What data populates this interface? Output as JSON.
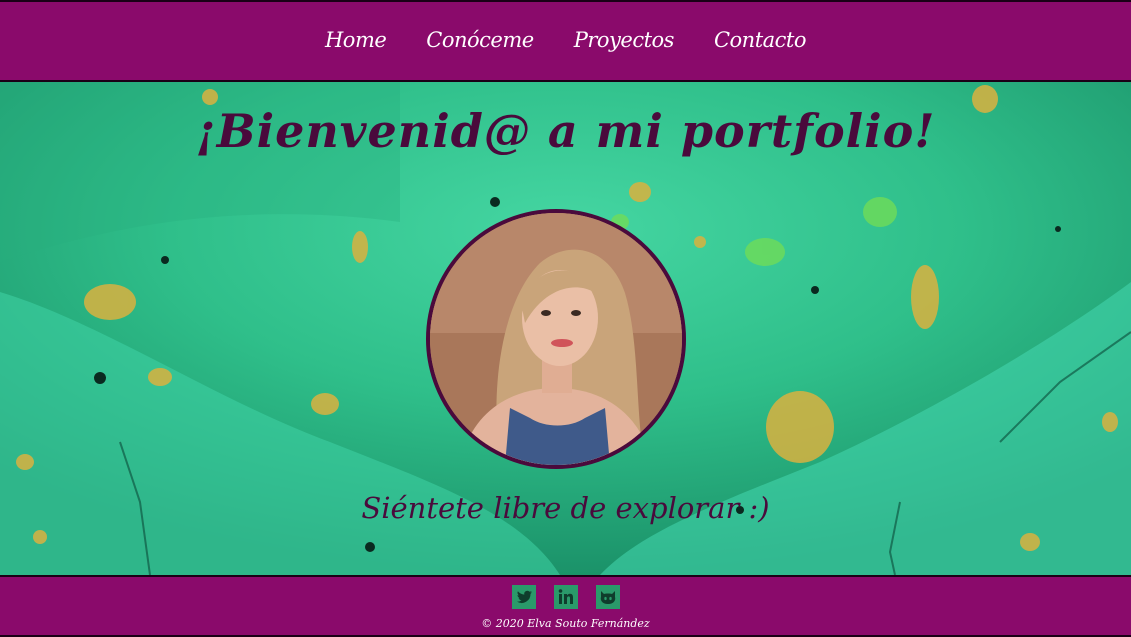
{
  "nav": {
    "items": [
      {
        "label": "Home"
      },
      {
        "label": "Conóceme"
      },
      {
        "label": "Proyectos"
      },
      {
        "label": "Contacto"
      }
    ]
  },
  "hero": {
    "title": "¡Bienvenid@ a mi portfolio!",
    "subtitle": "Siéntete libre de explorar :)"
  },
  "footer": {
    "social": [
      {
        "icon": "twitter-icon"
      },
      {
        "icon": "linkedin-icon"
      },
      {
        "icon": "github-icon"
      }
    ],
    "copyright": "© 2020 Elva Souto Fernández"
  },
  "colors": {
    "primary": "#8a0a6b",
    "title_text": "#4a0a3c",
    "hero_bg": "#2bb984",
    "icon_bg": "#2a9a6a"
  }
}
